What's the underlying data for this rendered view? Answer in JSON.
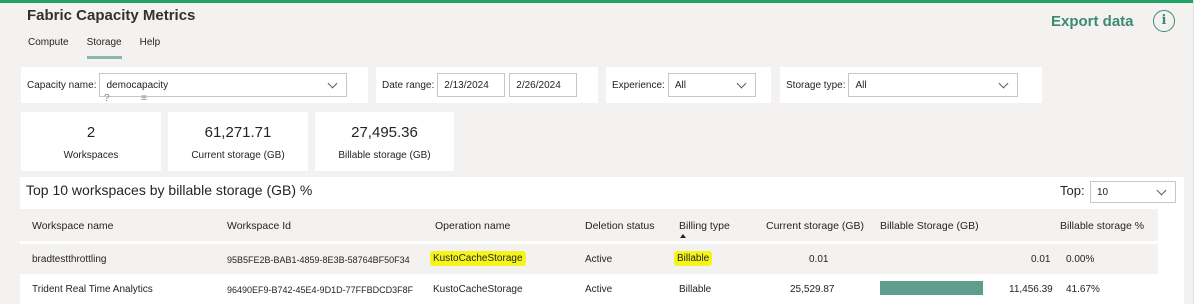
{
  "header": {
    "title": "Fabric Capacity Metrics",
    "tabs": [
      {
        "label": "Compute",
        "active": false
      },
      {
        "label": "Storage",
        "active": true
      },
      {
        "label": "Help",
        "active": false
      }
    ],
    "export_label": "Export data",
    "info_icon": "i"
  },
  "filters": {
    "capacity": {
      "label": "Capacity name:",
      "value": "democapacity"
    },
    "date_range": {
      "label": "Date range:",
      "start": "2/13/2024",
      "end": "2/26/2024"
    },
    "experience": {
      "label": "Experience:",
      "value": "All"
    },
    "storage_type": {
      "label": "Storage type:",
      "value": "All"
    },
    "help_glyph": "?",
    "filter_glyph": "≡"
  },
  "kpis": [
    {
      "value": "2",
      "label": "Workspaces"
    },
    {
      "value": "61,271.71",
      "label": "Current storage (GB)"
    },
    {
      "value": "27,495.36",
      "label": "Billable storage (GB)"
    }
  ],
  "table": {
    "title": "Top 10 workspaces by billable storage (GB) %",
    "top_label": "Top:",
    "top_value": "10",
    "columns": [
      "Workspace name",
      "Workspace Id",
      "Operation name",
      "Deletion status",
      "Billing type",
      "Current storage (GB)",
      "Billable Storage (GB)",
      "Billable storage %"
    ],
    "rows": [
      {
        "workspace_name": "bradtestthrottling",
        "workspace_id": "95B5FE2B-BAB1-4859-8E3B-58764BF50F34",
        "operation_name": "KustoCacheStorage",
        "deletion_status": "Active",
        "billing_type": "Billable",
        "current_storage": "0.01",
        "billable_storage": "0.01",
        "billable_storage_fraction": 0.0,
        "billable_pct": "0.00%"
      },
      {
        "workspace_name": "Trident Real Time Analytics",
        "workspace_id": "96490EF9-B742-45E4-9D1D-77FFBDCD3F8F",
        "operation_name": "KustoCacheStorage",
        "deletion_status": "Active",
        "billing_type": "Billable",
        "current_storage": "25,529.87",
        "billable_storage": "11,456.39",
        "billable_storage_fraction": 0.4167,
        "billable_pct": "41.67%"
      }
    ]
  },
  "colors": {
    "accent": "#3d8a70",
    "bar": "#5f9e8c",
    "highlight": "#f5f51c"
  }
}
